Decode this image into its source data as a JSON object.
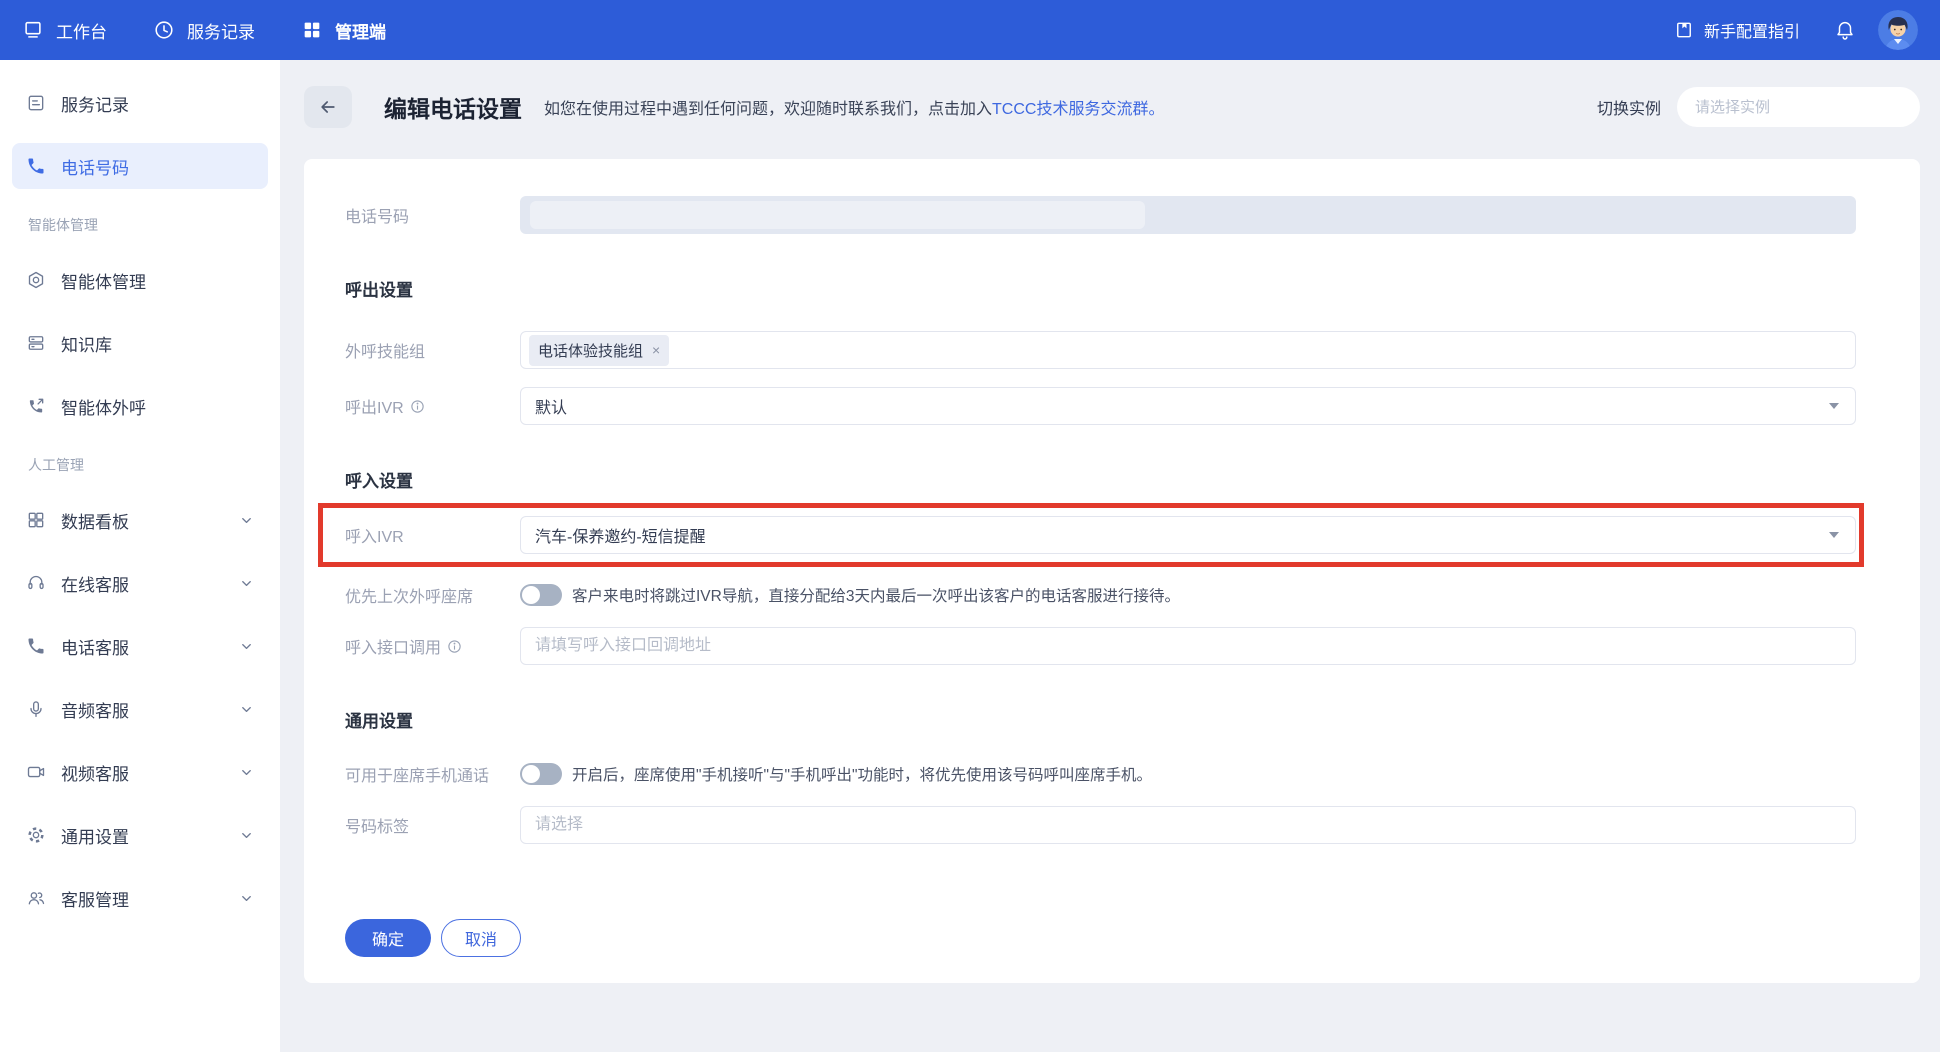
{
  "topnav": {
    "items": [
      {
        "label": "工作台",
        "icon": "workbench-icon"
      },
      {
        "label": "服务记录",
        "icon": "clock-icon"
      },
      {
        "label": "管理端",
        "icon": "grid-icon"
      }
    ],
    "guide_label": "新手配置指引"
  },
  "sidebar": {
    "top_items": [
      {
        "label": "服务记录",
        "icon": "document-icon",
        "active": false
      },
      {
        "label": "电话号码",
        "icon": "phone-icon",
        "active": true
      }
    ],
    "groups": [
      {
        "title": "智能体管理",
        "items": [
          {
            "label": "智能体管理",
            "icon": "hexagon-icon"
          },
          {
            "label": "知识库",
            "icon": "server-icon"
          },
          {
            "label": "智能体外呼",
            "icon": "phone-out-icon"
          }
        ]
      },
      {
        "title": "人工管理",
        "items": [
          {
            "label": "数据看板",
            "icon": "dashboard-icon"
          },
          {
            "label": "在线客服",
            "icon": "headset-icon"
          },
          {
            "label": "电话客服",
            "icon": "phone-icon"
          },
          {
            "label": "音频客服",
            "icon": "mic-icon"
          },
          {
            "label": "视频客服",
            "icon": "video-icon"
          },
          {
            "label": "通用设置",
            "icon": "gear-icon"
          },
          {
            "label": "客服管理",
            "icon": "people-icon"
          }
        ]
      }
    ]
  },
  "header": {
    "title": "编辑电话设置",
    "subtitle": "如您在使用过程中遇到任何问题，欢迎随时联系我们，点击加入",
    "subtitle_link": "TCCC技术服务交流群。",
    "switch_label": "切换实例",
    "switch_placeholder": "请选择实例"
  },
  "form": {
    "phone": {
      "label": "电话号码"
    },
    "outbound": {
      "title": "呼出设置",
      "skill_group": {
        "label": "外呼技能组",
        "tag": "电话体验技能组",
        "tag_remove": "×"
      },
      "ivr": {
        "label": "呼出IVR",
        "value": "默认"
      }
    },
    "inbound": {
      "title": "呼入设置",
      "ivr": {
        "label": "呼入IVR",
        "value": "汽车-保养邀约-短信提醒"
      },
      "prefer_last_agent": {
        "label": "优先上次外呼座席",
        "enabled": false,
        "desc": "客户来电时将跳过IVR导航，直接分配给3天内最后一次呼出该客户的电话客服进行接待。"
      },
      "callback": {
        "label": "呼入接口调用",
        "placeholder": "请填写呼入接口回调地址"
      }
    },
    "general": {
      "title": "通用设置",
      "mobile_call": {
        "label": "可用于座席手机通话",
        "enabled": false,
        "desc": "开启后，座席使用\"手机接听\"与\"手机呼出\"功能时，将优先使用该号码呼叫座席手机。"
      },
      "number_tag": {
        "label": "号码标签",
        "placeholder": "请选择"
      }
    },
    "actions": {
      "confirm": "确定",
      "cancel": "取消"
    }
  },
  "colors": {
    "navbar": "#2d5cd8",
    "accent": "#3f6ce4",
    "highlight_red": "#e23a2c",
    "active_item_bg": "#e9effd"
  }
}
